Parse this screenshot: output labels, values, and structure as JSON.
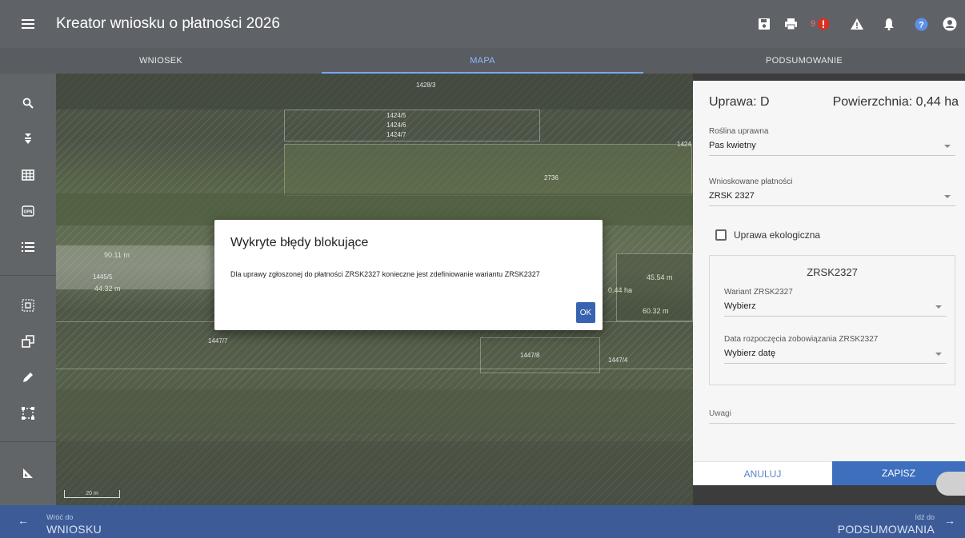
{
  "app": {
    "title": "Kreator wniosku o płatności 2026",
    "notification_count": "9"
  },
  "tabs": [
    {
      "label": "WNIOSEK",
      "active": false
    },
    {
      "label": "MAPA",
      "active": true
    },
    {
      "label": "PODSUMOWANIE",
      "active": false
    }
  ],
  "toolbar": {
    "items": [
      "search-icon",
      "parcel-pin-icon",
      "grid-icon",
      "orthophoto-icon",
      "list-icon",
      "select-area-icon",
      "copy-shape-icon",
      "pencil-icon",
      "rectangle-select-icon",
      "measure-angle-icon"
    ],
    "orto_label": "OPN"
  },
  "map": {
    "parcel_labels": [
      "1428/3",
      "1424/5",
      "1424/6",
      "1424/7",
      "1424",
      "2736",
      "1445/5",
      "1447/7",
      "1447/8",
      "1447/4"
    ],
    "measurements": [
      "90.11 m",
      "44.32 m",
      "0.44 ha",
      "45.54 m",
      "60.32 m"
    ],
    "scale": "20 m"
  },
  "panel": {
    "crop_label": "Uprawa: D",
    "area_label": "Powierzchnia: 0,44 ha",
    "plant": {
      "label": "Roślina uprawna",
      "value": "Pas kwietny"
    },
    "payments": {
      "label": "Wnioskowane płatności",
      "value": "ZRSK 2327"
    },
    "eco_checkbox": "Uprawa ekologiczna",
    "card": {
      "title": "ZRSK2327",
      "variant": {
        "label": "Wariant ZRSK2327",
        "value": "Wybierz"
      },
      "start_date": {
        "label": "Data rozpoczęcia zobowiązania ZRSK2327",
        "value": "Wybierz datę"
      }
    },
    "notes_placeholder": "Uwagi",
    "cancel": "ANULUJ",
    "save": "ZAPISZ"
  },
  "modal": {
    "title": "Wykryte błędy blokujące",
    "message": "Dla uprawy zgłoszonej do płatności ZRSK2327 konieczne jest zdefiniowanie wariantu ZRSK2327",
    "ok": "OK"
  },
  "bottom": {
    "back_small": "Wróć do",
    "back_big": "WNIOSKU",
    "fwd_small": "Idź do",
    "fwd_big": "PODSUMOWANIA"
  },
  "colors": {
    "appbar": "#5f6368",
    "accent": "#3d6fbe",
    "bottom_nav": "#3d5c97",
    "alert": "#d93025"
  }
}
